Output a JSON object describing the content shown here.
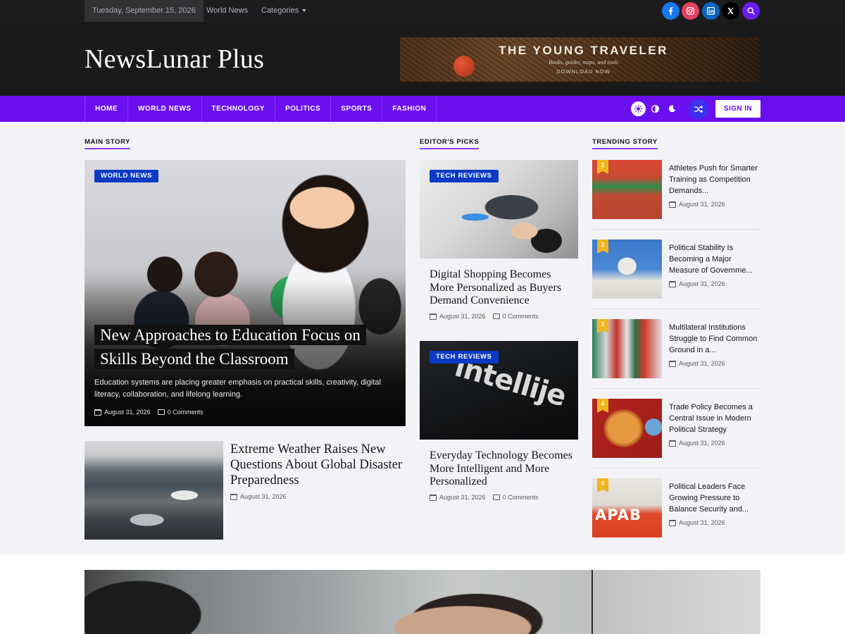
{
  "topbar": {
    "date": "Tuesday, September 15, 2026",
    "links": [
      "World News",
      "Categories"
    ],
    "social_icons": [
      "facebook-icon",
      "instagram-icon",
      "linkedin-icon",
      "x-icon",
      "search-icon"
    ]
  },
  "header": {
    "site_title": "NewsLunar Plus",
    "banner": {
      "title": "THE YOUNG TRAVELER",
      "subtitle": "Books, guides, maps, and tools",
      "cta": "DOWNLOAD NOW"
    }
  },
  "nav": {
    "items": [
      "HOME",
      "WORLD NEWS",
      "TECHNOLOGY",
      "POLITICS",
      "SPORTS",
      "FASHION"
    ],
    "sign_in": "SIGN IN",
    "mode_icons": [
      "light-mode-icon",
      "auto-mode-icon",
      "dark-mode-icon",
      "shuffle-icon"
    ]
  },
  "sections": {
    "main": "MAIN STORY",
    "editors": "EDITOR'S PICKS",
    "trending": "TRENDING STORY"
  },
  "main_story": {
    "category": "WORLD NEWS",
    "title_line1": "New Approaches to Education Focus on",
    "title_line2": "Skills Beyond the Classroom",
    "excerpt": "Education systems are placing greater emphasis on practical skills, creativity, digital literacy, collaboration, and lifelong learning.",
    "date": "August 31, 2026",
    "comments": "0 Comments"
  },
  "secondary_story": {
    "title": "Extreme Weather Raises New Questions About Global Disaster Preparedness",
    "date": "August 31, 2026"
  },
  "editors_picks": [
    {
      "category": "TECH REVIEWS",
      "title": "Digital Shopping Becomes More Personalized as Buyers Demand Convenience",
      "date": "August 31, 2026",
      "comments": "0 Comments"
    },
    {
      "category": "TECH REVIEWS",
      "image_text": "intellije",
      "title": "Everyday Technology Becomes More Intelligent and More Personalized",
      "date": "August 31, 2026",
      "comments": "0 Comments"
    }
  ],
  "trending": [
    {
      "rank": "1",
      "title": "Athletes Push for Smarter Training as Competition Demands...",
      "date": "August 31, 2026"
    },
    {
      "rank": "2",
      "title": "Political Stability Is Becoming a Major Measure of Governme...",
      "date": "August 31, 2026"
    },
    {
      "rank": "3",
      "title": "Multilateral Institutions Struggle to Find Common Ground in a...",
      "date": "August 31, 2026"
    },
    {
      "rank": "4",
      "title": "Trade Policy Becomes a Central Issue in Modern Political Strategy",
      "date": "August 31, 2026"
    },
    {
      "rank": "5",
      "title": "Political Leaders Face Growing Pressure to Balance Security and...",
      "date": "August 31, 2026",
      "image_text": "APAB"
    }
  ],
  "colors": {
    "accent": "#6a0ff0",
    "badge": "#0b3bc4",
    "rank": "#f0b51e",
    "header_bg": "#1a1a1b",
    "topbar_bg": "#1c1c1e"
  }
}
